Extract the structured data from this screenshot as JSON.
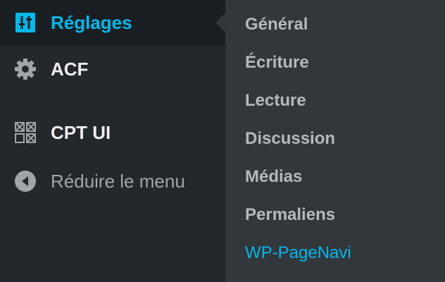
{
  "colors": {
    "sidebar_bg": "#23282d",
    "current_item_bg": "#191e23",
    "submenu_bg": "#32373c",
    "accent": "#00b9eb",
    "text": "#eeeeee",
    "muted_text": "#a0a5aa",
    "submenu_text": "#b4b9be"
  },
  "sidebar": {
    "items": [
      {
        "label": "Réglages",
        "icon": "settings-sliders-icon",
        "current": true
      },
      {
        "label": "ACF",
        "icon": "gear-icon",
        "current": false
      },
      {
        "label": "CPT UI",
        "icon": "grid-boxes-icon",
        "current": false
      }
    ],
    "collapse": {
      "label": "Réduire le menu",
      "icon": "collapse-arrow-icon"
    }
  },
  "submenu": {
    "items": [
      {
        "label": "Général",
        "active": false
      },
      {
        "label": "Écriture",
        "active": false
      },
      {
        "label": "Lecture",
        "active": false
      },
      {
        "label": "Discussion",
        "active": false
      },
      {
        "label": "Médias",
        "active": false
      },
      {
        "label": "Permaliens",
        "active": false
      },
      {
        "label": "WP-PageNavi",
        "active": true
      }
    ]
  }
}
